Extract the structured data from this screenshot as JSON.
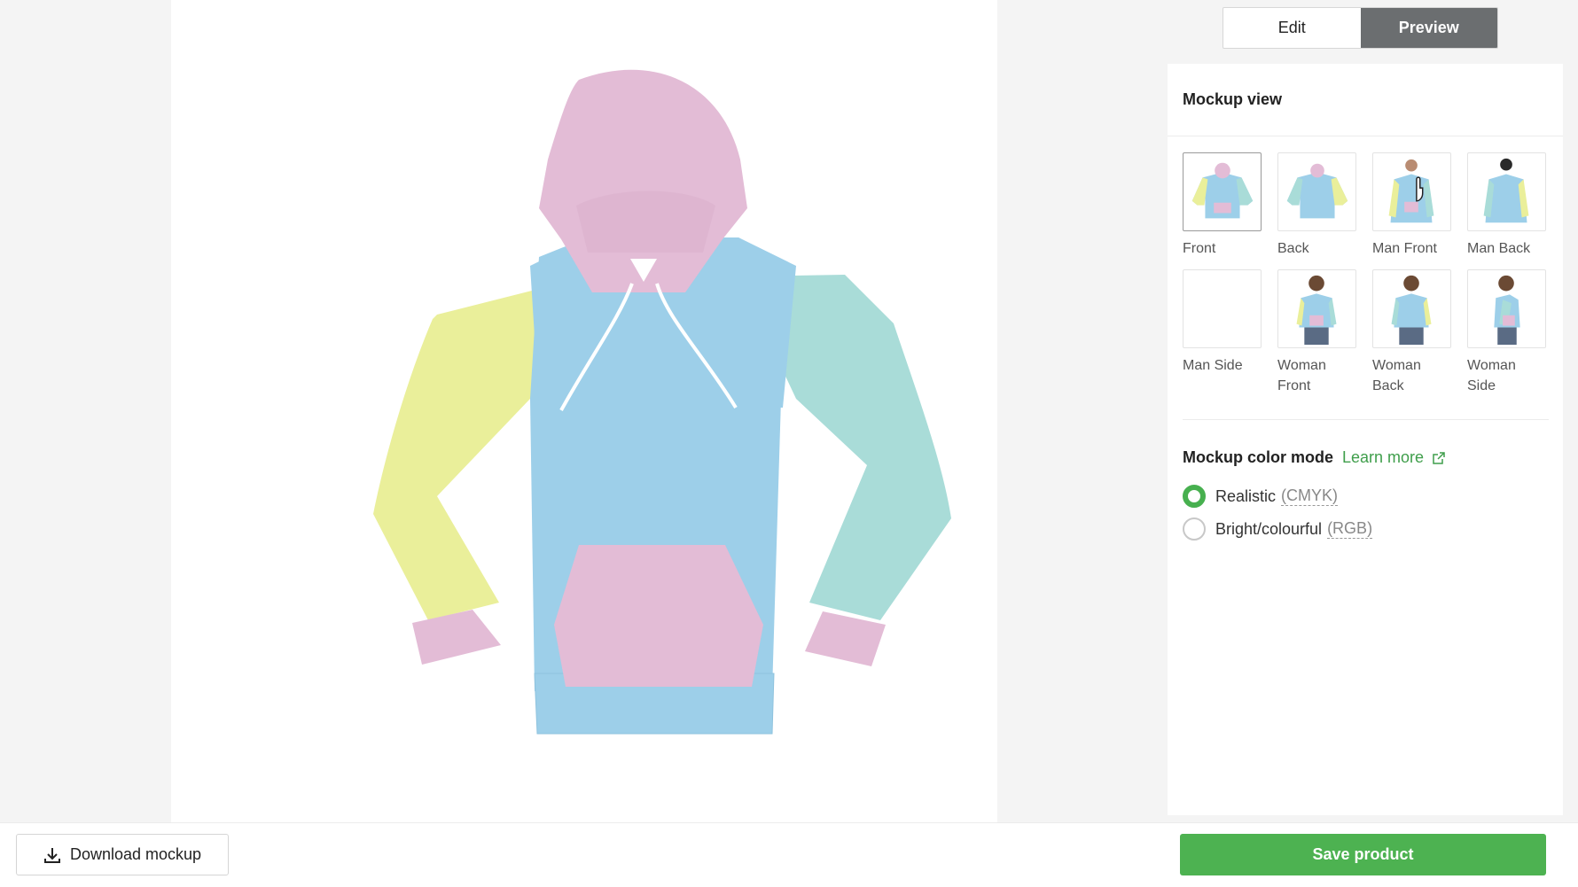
{
  "toggle": {
    "edit_label": "Edit",
    "preview_label": "Preview",
    "active": "Preview"
  },
  "panel": {
    "title": "Mockup view",
    "thumbnails": [
      {
        "label": "Front",
        "selected": true
      },
      {
        "label": "Back",
        "selected": false
      },
      {
        "label": "Man Front",
        "selected": false
      },
      {
        "label": "Man Back",
        "selected": false
      },
      {
        "label": "Man Side",
        "selected": false
      },
      {
        "label": "Woman Front",
        "selected": false
      },
      {
        "label": "Woman Back",
        "selected": false
      },
      {
        "label": "Woman Side",
        "selected": false
      }
    ],
    "color_mode": {
      "title": "Mockup color mode",
      "learn_more": "Learn more",
      "options": [
        {
          "label": "Realistic",
          "hint": "(CMYK)",
          "checked": true
        },
        {
          "label": "Bright/colourful",
          "hint": "(RGB)",
          "checked": false
        }
      ]
    }
  },
  "bottom": {
    "download_label": "Download mockup",
    "save_label": "Save product"
  },
  "colors": {
    "pink": "#e3bcd6",
    "blue": "#9dcfe9",
    "yellow": "#eaef9a",
    "mint": "#a9dcd8",
    "accent_green": "#4db251",
    "toggle_active": "#6b6e70"
  },
  "icons": {
    "download": "download-icon",
    "external_link": "external-link-icon",
    "cursor": "hand-cursor-icon"
  }
}
